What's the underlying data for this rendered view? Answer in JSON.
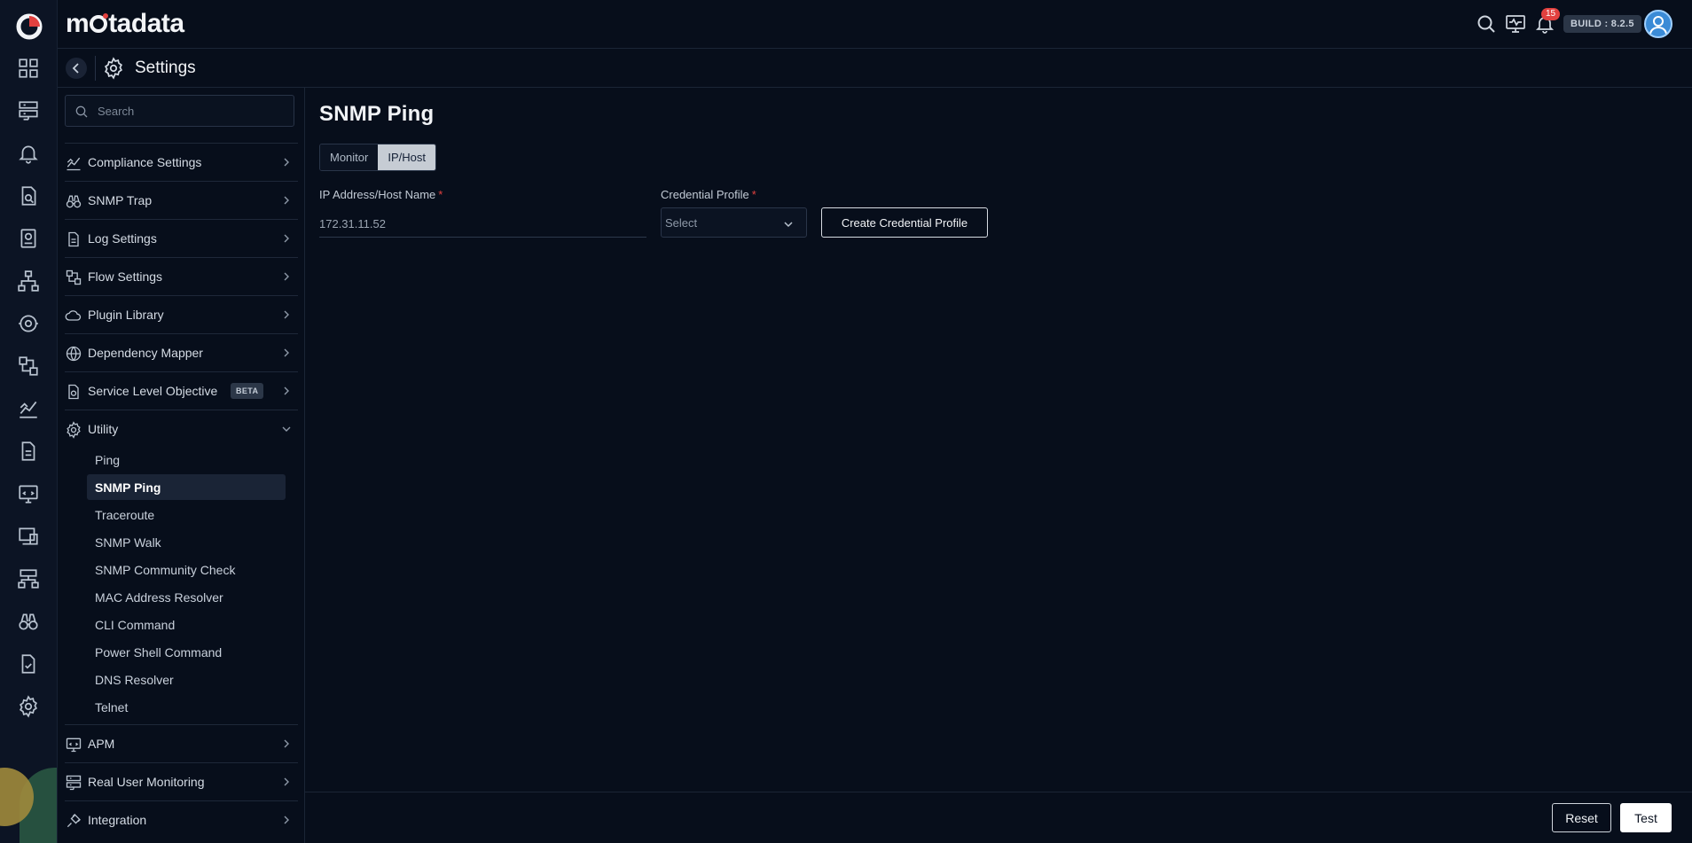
{
  "brand": {
    "name_prefix": "m",
    "name_suffix": "tadata"
  },
  "rail": {
    "icons": [
      "dashboard-icon",
      "server-icon",
      "bell-icon",
      "monitor-search-icon",
      "report-icon",
      "topology-icon",
      "automation-icon",
      "flow-icon",
      "chart-icon",
      "document-icon",
      "apm-icon",
      "device-icon",
      "network-icon",
      "binoculars-icon",
      "checklist-icon",
      "settings-icon"
    ]
  },
  "topbar": {
    "notification_count": "15",
    "build_label": "BUILD : 8.2.5"
  },
  "header": {
    "title": "Settings"
  },
  "sidebar": {
    "search_placeholder": "Search",
    "items": [
      {
        "label": "Compliance Settings"
      },
      {
        "label": "SNMP Trap"
      },
      {
        "label": "Log Settings"
      },
      {
        "label": "Flow Settings"
      },
      {
        "label": "Plugin Library"
      },
      {
        "label": "Dependency Mapper"
      },
      {
        "label": "Service Level Objective",
        "badge": "BETA"
      },
      {
        "label": "Utility"
      }
    ],
    "utility_items": [
      "Ping",
      "SNMP Ping",
      "Traceroute",
      "SNMP Walk",
      "SNMP Community Check",
      "MAC Address Resolver",
      "CLI Command",
      "Power Shell Command",
      "DNS Resolver",
      "Telnet"
    ],
    "bottom_items": [
      {
        "label": "APM"
      },
      {
        "label": "Real User Monitoring"
      },
      {
        "label": "Integration"
      }
    ]
  },
  "main": {
    "title": "SNMP Ping",
    "tabs": [
      {
        "label": "Monitor"
      },
      {
        "label": "IP/Host"
      }
    ],
    "ip_label": "IP Address/Host Name",
    "ip_value": "172.31.11.52",
    "credential_label": "Credential Profile",
    "credential_placeholder": "Select",
    "required_mark": "*",
    "create_button": "Create Credential Profile"
  },
  "footer": {
    "reset": "Reset",
    "test": "Test"
  },
  "colors": {
    "accent_red": "#e2413f",
    "bg": "#070e1b"
  }
}
